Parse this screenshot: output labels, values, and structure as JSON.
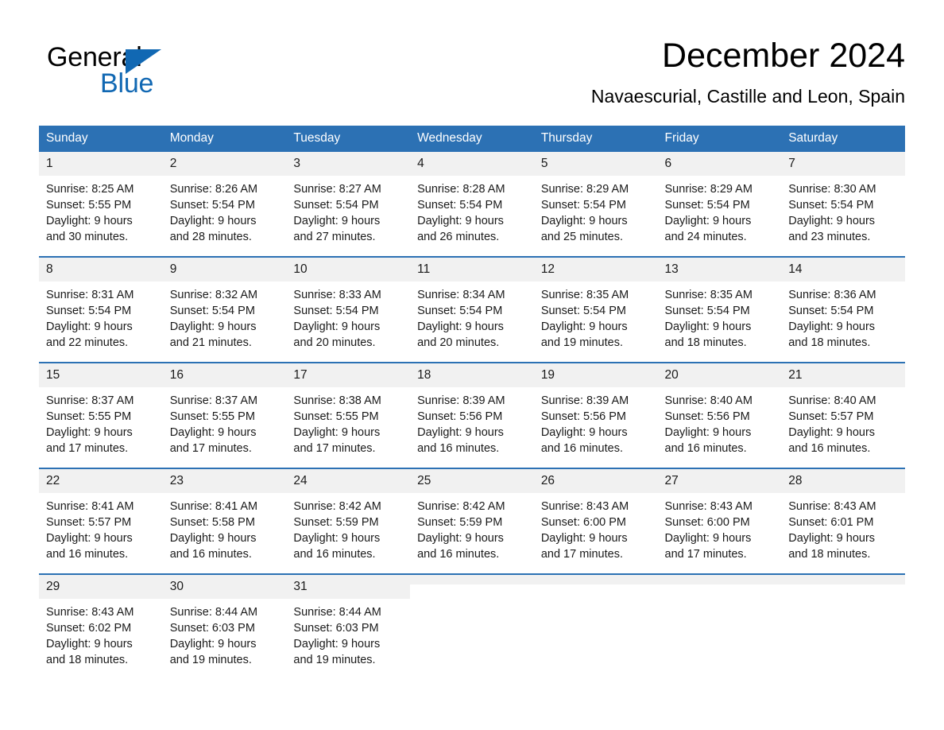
{
  "brand": {
    "name_part1": "General",
    "name_part2": "Blue",
    "accent_color": "#1168b3"
  },
  "header": {
    "title": "December 2024",
    "subtitle": "Navaescurial, Castille and Leon, Spain"
  },
  "theme": {
    "header_bg": "#2c71b4",
    "daynum_bg": "#f1f1f1",
    "row_divider": "#2c71b4"
  },
  "calendar": {
    "weekday_headers": [
      "Sunday",
      "Monday",
      "Tuesday",
      "Wednesday",
      "Thursday",
      "Friday",
      "Saturday"
    ],
    "weeks": [
      [
        {
          "day": "1",
          "sunrise": "Sunrise: 8:25 AM",
          "sunset": "Sunset: 5:55 PM",
          "daylight_line1": "Daylight: 9 hours",
          "daylight_line2": "and 30 minutes."
        },
        {
          "day": "2",
          "sunrise": "Sunrise: 8:26 AM",
          "sunset": "Sunset: 5:54 PM",
          "daylight_line1": "Daylight: 9 hours",
          "daylight_line2": "and 28 minutes."
        },
        {
          "day": "3",
          "sunrise": "Sunrise: 8:27 AM",
          "sunset": "Sunset: 5:54 PM",
          "daylight_line1": "Daylight: 9 hours",
          "daylight_line2": "and 27 minutes."
        },
        {
          "day": "4",
          "sunrise": "Sunrise: 8:28 AM",
          "sunset": "Sunset: 5:54 PM",
          "daylight_line1": "Daylight: 9 hours",
          "daylight_line2": "and 26 minutes."
        },
        {
          "day": "5",
          "sunrise": "Sunrise: 8:29 AM",
          "sunset": "Sunset: 5:54 PM",
          "daylight_line1": "Daylight: 9 hours",
          "daylight_line2": "and 25 minutes."
        },
        {
          "day": "6",
          "sunrise": "Sunrise: 8:29 AM",
          "sunset": "Sunset: 5:54 PM",
          "daylight_line1": "Daylight: 9 hours",
          "daylight_line2": "and 24 minutes."
        },
        {
          "day": "7",
          "sunrise": "Sunrise: 8:30 AM",
          "sunset": "Sunset: 5:54 PM",
          "daylight_line1": "Daylight: 9 hours",
          "daylight_line2": "and 23 minutes."
        }
      ],
      [
        {
          "day": "8",
          "sunrise": "Sunrise: 8:31 AM",
          "sunset": "Sunset: 5:54 PM",
          "daylight_line1": "Daylight: 9 hours",
          "daylight_line2": "and 22 minutes."
        },
        {
          "day": "9",
          "sunrise": "Sunrise: 8:32 AM",
          "sunset": "Sunset: 5:54 PM",
          "daylight_line1": "Daylight: 9 hours",
          "daylight_line2": "and 21 minutes."
        },
        {
          "day": "10",
          "sunrise": "Sunrise: 8:33 AM",
          "sunset": "Sunset: 5:54 PM",
          "daylight_line1": "Daylight: 9 hours",
          "daylight_line2": "and 20 minutes."
        },
        {
          "day": "11",
          "sunrise": "Sunrise: 8:34 AM",
          "sunset": "Sunset: 5:54 PM",
          "daylight_line1": "Daylight: 9 hours",
          "daylight_line2": "and 20 minutes."
        },
        {
          "day": "12",
          "sunrise": "Sunrise: 8:35 AM",
          "sunset": "Sunset: 5:54 PM",
          "daylight_line1": "Daylight: 9 hours",
          "daylight_line2": "and 19 minutes."
        },
        {
          "day": "13",
          "sunrise": "Sunrise: 8:35 AM",
          "sunset": "Sunset: 5:54 PM",
          "daylight_line1": "Daylight: 9 hours",
          "daylight_line2": "and 18 minutes."
        },
        {
          "day": "14",
          "sunrise": "Sunrise: 8:36 AM",
          "sunset": "Sunset: 5:54 PM",
          "daylight_line1": "Daylight: 9 hours",
          "daylight_line2": "and 18 minutes."
        }
      ],
      [
        {
          "day": "15",
          "sunrise": "Sunrise: 8:37 AM",
          "sunset": "Sunset: 5:55 PM",
          "daylight_line1": "Daylight: 9 hours",
          "daylight_line2": "and 17 minutes."
        },
        {
          "day": "16",
          "sunrise": "Sunrise: 8:37 AM",
          "sunset": "Sunset: 5:55 PM",
          "daylight_line1": "Daylight: 9 hours",
          "daylight_line2": "and 17 minutes."
        },
        {
          "day": "17",
          "sunrise": "Sunrise: 8:38 AM",
          "sunset": "Sunset: 5:55 PM",
          "daylight_line1": "Daylight: 9 hours",
          "daylight_line2": "and 17 minutes."
        },
        {
          "day": "18",
          "sunrise": "Sunrise: 8:39 AM",
          "sunset": "Sunset: 5:56 PM",
          "daylight_line1": "Daylight: 9 hours",
          "daylight_line2": "and 16 minutes."
        },
        {
          "day": "19",
          "sunrise": "Sunrise: 8:39 AM",
          "sunset": "Sunset: 5:56 PM",
          "daylight_line1": "Daylight: 9 hours",
          "daylight_line2": "and 16 minutes."
        },
        {
          "day": "20",
          "sunrise": "Sunrise: 8:40 AM",
          "sunset": "Sunset: 5:56 PM",
          "daylight_line1": "Daylight: 9 hours",
          "daylight_line2": "and 16 minutes."
        },
        {
          "day": "21",
          "sunrise": "Sunrise: 8:40 AM",
          "sunset": "Sunset: 5:57 PM",
          "daylight_line1": "Daylight: 9 hours",
          "daylight_line2": "and 16 minutes."
        }
      ],
      [
        {
          "day": "22",
          "sunrise": "Sunrise: 8:41 AM",
          "sunset": "Sunset: 5:57 PM",
          "daylight_line1": "Daylight: 9 hours",
          "daylight_line2": "and 16 minutes."
        },
        {
          "day": "23",
          "sunrise": "Sunrise: 8:41 AM",
          "sunset": "Sunset: 5:58 PM",
          "daylight_line1": "Daylight: 9 hours",
          "daylight_line2": "and 16 minutes."
        },
        {
          "day": "24",
          "sunrise": "Sunrise: 8:42 AM",
          "sunset": "Sunset: 5:59 PM",
          "daylight_line1": "Daylight: 9 hours",
          "daylight_line2": "and 16 minutes."
        },
        {
          "day": "25",
          "sunrise": "Sunrise: 8:42 AM",
          "sunset": "Sunset: 5:59 PM",
          "daylight_line1": "Daylight: 9 hours",
          "daylight_line2": "and 16 minutes."
        },
        {
          "day": "26",
          "sunrise": "Sunrise: 8:43 AM",
          "sunset": "Sunset: 6:00 PM",
          "daylight_line1": "Daylight: 9 hours",
          "daylight_line2": "and 17 minutes."
        },
        {
          "day": "27",
          "sunrise": "Sunrise: 8:43 AM",
          "sunset": "Sunset: 6:00 PM",
          "daylight_line1": "Daylight: 9 hours",
          "daylight_line2": "and 17 minutes."
        },
        {
          "day": "28",
          "sunrise": "Sunrise: 8:43 AM",
          "sunset": "Sunset: 6:01 PM",
          "daylight_line1": "Daylight: 9 hours",
          "daylight_line2": "and 18 minutes."
        }
      ],
      [
        {
          "day": "29",
          "sunrise": "Sunrise: 8:43 AM",
          "sunset": "Sunset: 6:02 PM",
          "daylight_line1": "Daylight: 9 hours",
          "daylight_line2": "and 18 minutes."
        },
        {
          "day": "30",
          "sunrise": "Sunrise: 8:44 AM",
          "sunset": "Sunset: 6:03 PM",
          "daylight_line1": "Daylight: 9 hours",
          "daylight_line2": "and 19 minutes."
        },
        {
          "day": "31",
          "sunrise": "Sunrise: 8:44 AM",
          "sunset": "Sunset: 6:03 PM",
          "daylight_line1": "Daylight: 9 hours",
          "daylight_line2": "and 19 minutes."
        },
        {
          "day": "",
          "sunrise": "",
          "sunset": "",
          "daylight_line1": "",
          "daylight_line2": ""
        },
        {
          "day": "",
          "sunrise": "",
          "sunset": "",
          "daylight_line1": "",
          "daylight_line2": ""
        },
        {
          "day": "",
          "sunrise": "",
          "sunset": "",
          "daylight_line1": "",
          "daylight_line2": ""
        },
        {
          "day": "",
          "sunrise": "",
          "sunset": "",
          "daylight_line1": "",
          "daylight_line2": ""
        }
      ]
    ]
  }
}
